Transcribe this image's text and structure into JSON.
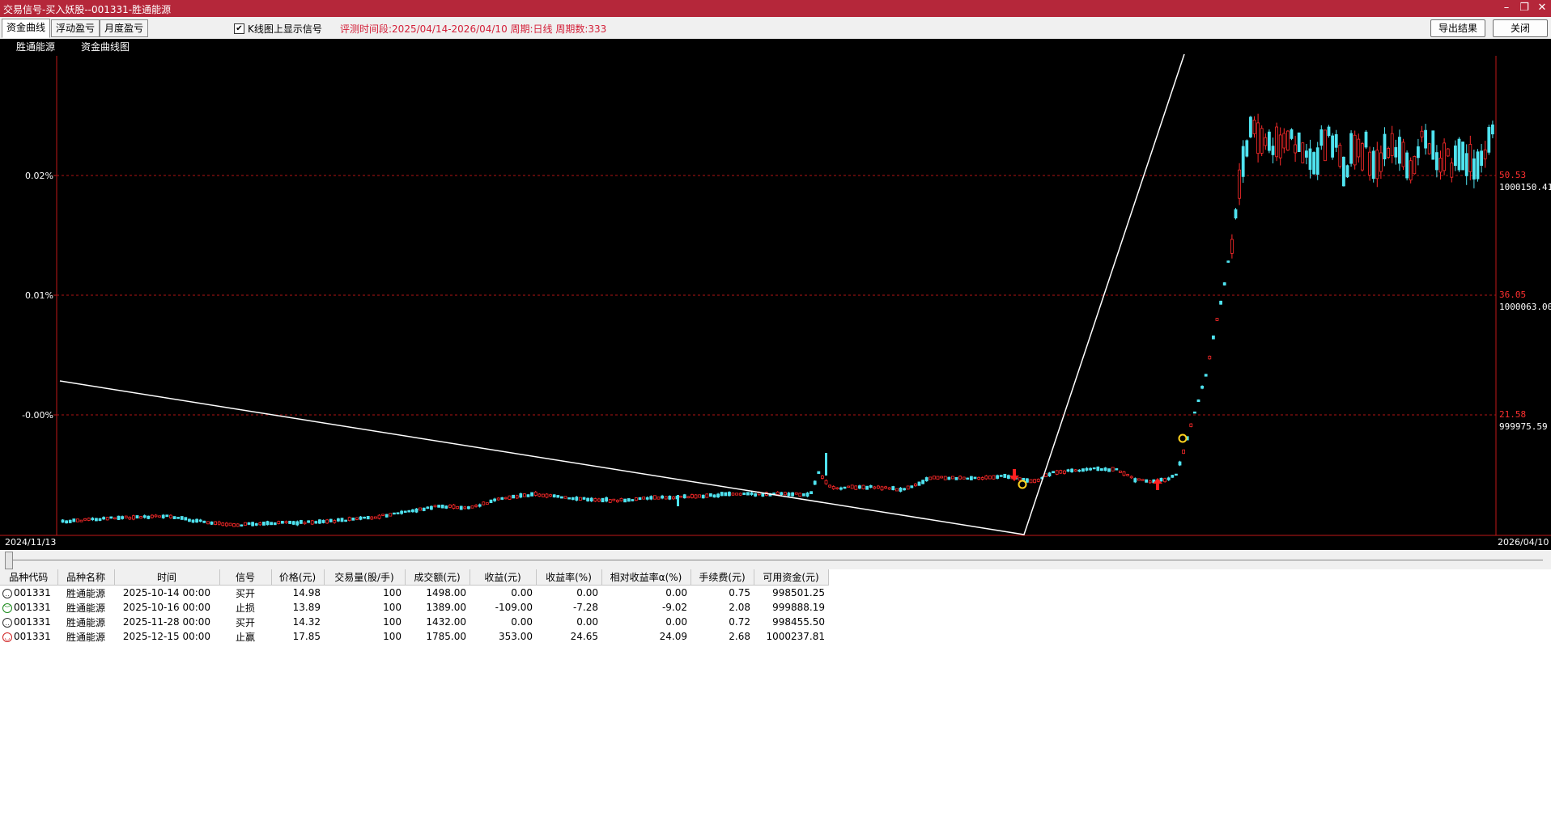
{
  "window": {
    "title": "交易信号-买入妖股--001331-胜通能源",
    "min_glyph": "–",
    "restore_glyph": "❐",
    "close_glyph": "✕"
  },
  "toolbar": {
    "tabs": [
      "资金曲线",
      "浮动盈亏",
      "月度盈亏"
    ],
    "checkbox_label": "K线图上显示信号",
    "checkbox_checked": true,
    "checkbox_glyph": "✔",
    "info": "评测时间段:2025/04/14-2026/04/10  周期:日线  周期数:333",
    "export_label": "导出结果",
    "close_label": "关闭"
  },
  "chart_panel": {
    "subtabs": [
      "胜通能源",
      "资金曲线图"
    ],
    "left_axis_labels": [
      "0.02%",
      "0.01%",
      "-0.00%"
    ],
    "right_price_labels": [
      "50.53",
      "36.05",
      "21.58"
    ],
    "right_capital_labels": [
      "1000150.41",
      "1000063.00",
      "999975.59"
    ],
    "date_start": "2024/11/13",
    "date_end": "2026/04/10",
    "colors": {
      "up": "#ff2a2a",
      "down": "#4fe3f0",
      "equity": "#ffffff",
      "grid": "#c01818"
    }
  },
  "table": {
    "headers": [
      "品种代码",
      "品种名称",
      "时间",
      "信号",
      "价格(元)",
      "交易量(股/手)",
      "成交额(元)",
      "收益(元)",
      "收益率(%)",
      "相对收益率α(%)",
      "手续费(元)",
      "可用资金(元)"
    ],
    "rows": [
      {
        "face": "neutral",
        "code": "001331",
        "name": "胜通能源",
        "time": "2025-10-14 00:00",
        "signal": "买开",
        "price": "14.98",
        "volume": "100",
        "amount": "1498.00",
        "profit": "0.00",
        "rate": "0.00",
        "alpha": "0.00",
        "fee": "0.75",
        "capital": "998501.25"
      },
      {
        "face": "sad",
        "code": "001331",
        "name": "胜通能源",
        "time": "2025-10-16 00:00",
        "signal": "止损",
        "price": "13.89",
        "volume": "100",
        "amount": "1389.00",
        "profit": "-109.00",
        "rate": "-7.28",
        "alpha": "-9.02",
        "fee": "2.08",
        "capital": "999888.19"
      },
      {
        "face": "neutral",
        "code": "001331",
        "name": "胜通能源",
        "time": "2025-11-28 00:00",
        "signal": "买开",
        "price": "14.32",
        "volume": "100",
        "amount": "1432.00",
        "profit": "0.00",
        "rate": "0.00",
        "alpha": "0.00",
        "fee": "0.72",
        "capital": "998455.50"
      },
      {
        "face": "happy",
        "code": "001331",
        "name": "胜通能源",
        "time": "2025-12-15 00:00",
        "signal": "止赢",
        "price": "17.85",
        "volume": "100",
        "amount": "1785.00",
        "profit": "353.00",
        "rate": "24.65",
        "alpha": "24.09",
        "fee": "2.68",
        "capital": "1000237.81"
      }
    ]
  }
}
